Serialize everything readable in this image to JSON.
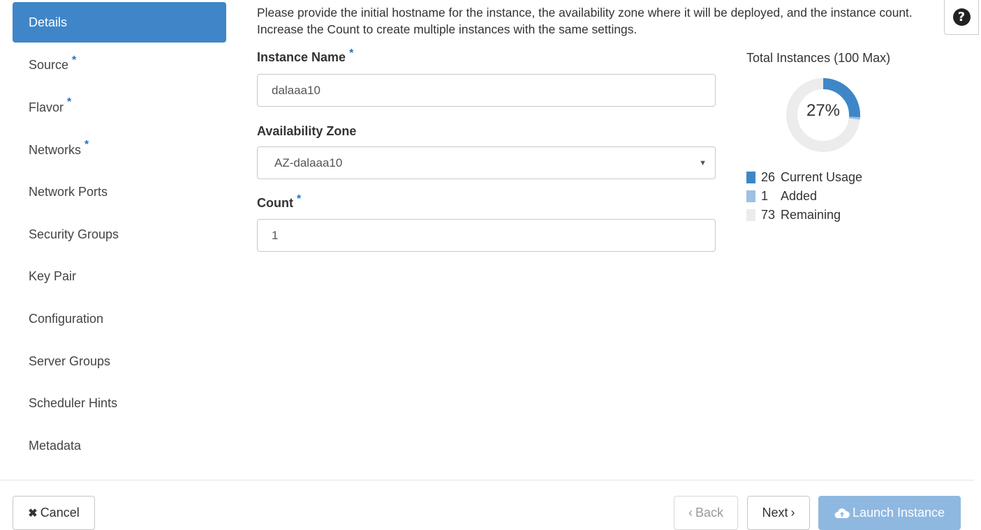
{
  "sidebar": {
    "items": [
      {
        "label": "Details",
        "required": false,
        "active": true
      },
      {
        "label": "Source",
        "required": true
      },
      {
        "label": "Flavor",
        "required": true
      },
      {
        "label": "Networks",
        "required": true
      },
      {
        "label": "Network Ports",
        "required": false
      },
      {
        "label": "Security Groups",
        "required": false
      },
      {
        "label": "Key Pair",
        "required": false
      },
      {
        "label": "Configuration",
        "required": false
      },
      {
        "label": "Server Groups",
        "required": false
      },
      {
        "label": "Scheduler Hints",
        "required": false
      },
      {
        "label": "Metadata",
        "required": false
      }
    ],
    "required_marker": "*"
  },
  "intro": {
    "text": "Please provide the initial hostname for the instance, the availability zone where it will be deployed, and the instance count. Increase the Count to create multiple instances with the same settings."
  },
  "help": {
    "icon": "question-icon",
    "glyph": "?"
  },
  "form": {
    "instance_name": {
      "label": "Instance Name",
      "value": "dalaaa10"
    },
    "availability_zone": {
      "label": "Availability Zone",
      "value": "AZ-dalaaa10"
    },
    "count": {
      "label": "Count",
      "value": "1"
    }
  },
  "chart_data": {
    "type": "pie",
    "title": "Total Instances (100 Max)",
    "center_label": "27%",
    "max": 100,
    "slices": [
      {
        "name": "Current Usage",
        "value": 26,
        "color": "#3f86c8"
      },
      {
        "name": "Added",
        "value": 1,
        "color": "#9dc0e3"
      },
      {
        "name": "Remaining",
        "value": 73,
        "color": "#ececec"
      }
    ]
  },
  "footer": {
    "cancel_label": "Cancel",
    "back_label": "Back",
    "next_label": "Next",
    "launch_label": "Launch Instance",
    "back_glyph": "‹",
    "next_glyph": "›",
    "cancel_glyph": "✖"
  },
  "colors": {
    "accent": "#3f86c8",
    "accent_light": "#9dc0e3",
    "primary_disabled": "#8fb8e0"
  }
}
